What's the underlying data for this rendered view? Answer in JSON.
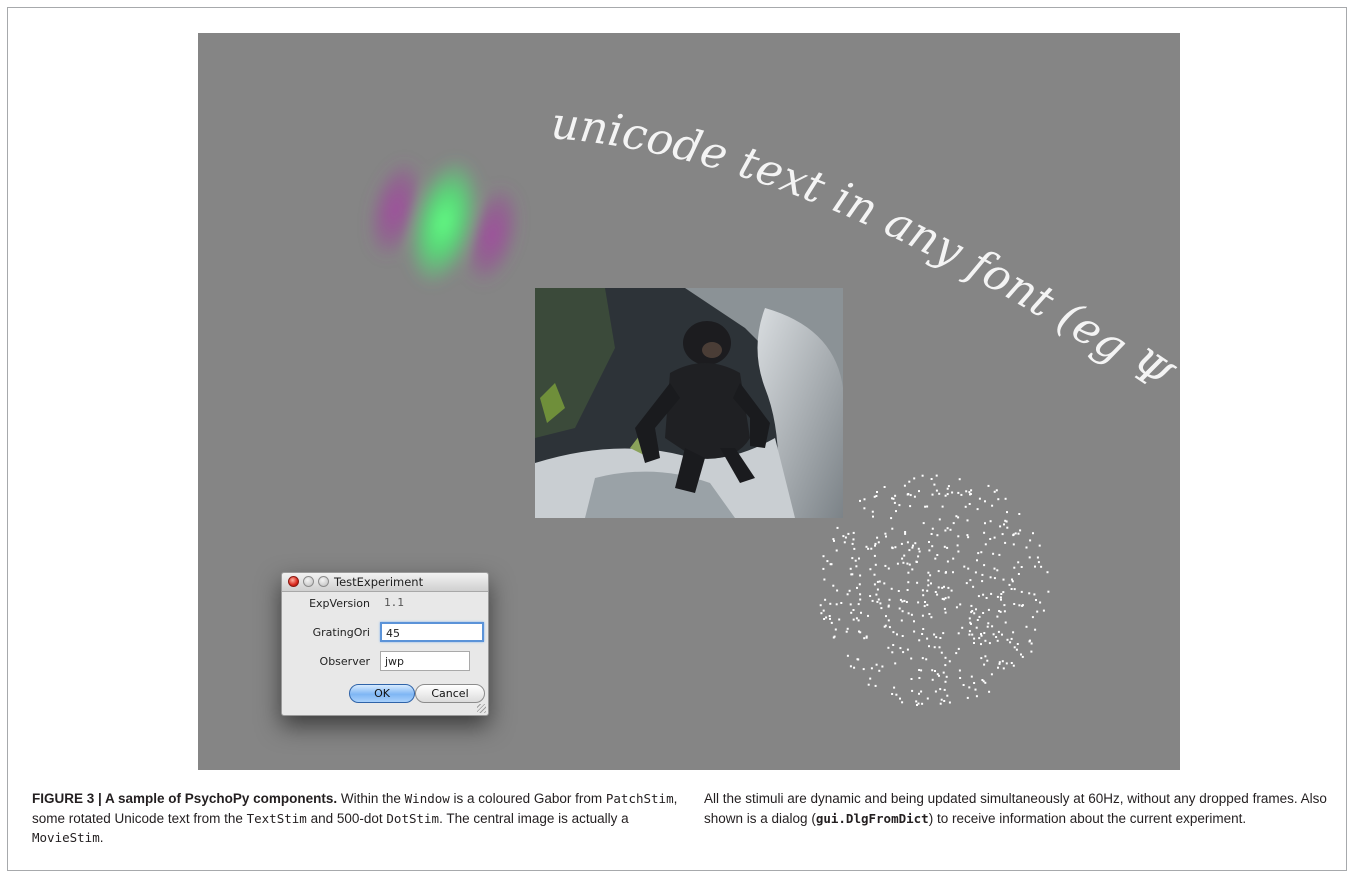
{
  "stimulus": {
    "rotated_text": "unicode text in any font (eg Ψ ℔ Σ)",
    "colors": {
      "background": "#858585",
      "gabor_center": "#5cf07c",
      "gabor_flank": "#a24ca0",
      "text": "#f4f4f4",
      "dots": "#ffffff"
    },
    "dot_count": 500
  },
  "dialog": {
    "title": "TestExperiment",
    "fields": {
      "exp_version": {
        "label": "ExpVersion",
        "value": "1.1"
      },
      "grating_ori": {
        "label": "GratingOri",
        "value": "45"
      },
      "observer": {
        "label": "Observer",
        "value": "jwp"
      }
    },
    "ok_label": "OK",
    "cancel_label": "Cancel"
  },
  "caption": {
    "figure_label": "FIGURE 3 | A sample of PsychoPy components.",
    "left": {
      "s1": " Within the ",
      "c1": "Window",
      "s2": " is a coloured Gabor from ",
      "c2": "PatchStim",
      "s3": ", some rotated Unicode text from the ",
      "c3": "TextStim",
      "s4": " and 500-dot ",
      "c4": "DotStim",
      "s5": ". The central image is actually a ",
      "c5": "MovieStim",
      "s6": "."
    },
    "right": {
      "s1": "All the stimuli are dynamic and being updated simultaneously at 60Hz, without any dropped frames. Also shown is a dialog (",
      "c1": "gui.DlgFromDict",
      "s2": ") to receive information about the current experiment."
    }
  }
}
